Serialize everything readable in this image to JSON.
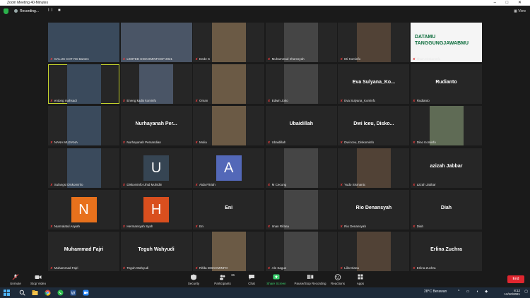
{
  "window": {
    "title": "Zoom Meeting 40-Minutes",
    "controls": "–  □  ✕"
  },
  "topbar": {
    "recording_label": "Recording...",
    "pause_label": "II ■",
    "view_label": "▦ View"
  },
  "participants": [
    {
      "name": "GALUS COT RS Banten",
      "type": "video"
    },
    {
      "name": "LIMITED DISKOMINFOSP 2021",
      "type": "video"
    },
    {
      "name": "Dede S",
      "type": "video"
    },
    {
      "name": "Muhammad Irhamsyah",
      "type": "video"
    },
    {
      "name": "Eti Kominfo",
      "type": "video"
    },
    {
      "name": "Ilham Diskomnfo",
      "type": "video",
      "banner": "DATAMU TANGGUNGJAWABMU"
    },
    {
      "name": "entong mahsadi",
      "type": "video",
      "active": true
    },
    {
      "name": "Eneng kadis kominfo",
      "type": "video"
    },
    {
      "name": "Oman",
      "type": "video"
    },
    {
      "name": "Edwin Joko",
      "type": "video"
    },
    {
      "name": "Eva Sulyana_Kominfo",
      "type": "text",
      "display": "Eva Sulyana_Ko..."
    },
    {
      "name": "Rudianto",
      "type": "text",
      "display": "Rudianto"
    },
    {
      "name": "NANA MUJIANA",
      "type": "video"
    },
    {
      "name": "Nurhayanah Persandian",
      "type": "text",
      "display": "Nurhayanah Per..."
    },
    {
      "name": "Mulia",
      "type": "video"
    },
    {
      "name": "Ubaidillah",
      "type": "text",
      "display": "Ubaidillah"
    },
    {
      "name": "Dwi Iceu, Diskominfo",
      "type": "text",
      "display": "Dwi Iceu, Disko..."
    },
    {
      "name": "Dino Kominfo",
      "type": "video"
    },
    {
      "name": "Sulangsi Diskominfo",
      "type": "video"
    },
    {
      "name": "Diskominfo Uhtd Muhidin",
      "type": "avatar",
      "letter": "U",
      "color": "#364553"
    },
    {
      "name": "Aida Fitriah",
      "type": "avatar",
      "letter": "A",
      "color": "#5368b8"
    },
    {
      "name": "M Cecung",
      "type": "video"
    },
    {
      "name": "Yudo Sismanto",
      "type": "video"
    },
    {
      "name": "azzah Jabbar",
      "type": "text",
      "display": "azizah Jabbar"
    },
    {
      "name": "Nurmalatul Asyiah",
      "type": "avatar",
      "letter": "N",
      "color": "#e8711c"
    },
    {
      "name": "Hermansyah Syah",
      "type": "avatar",
      "letter": "H",
      "color": "#d94f1e"
    },
    {
      "name": "Eni",
      "type": "text",
      "display": "Eni"
    },
    {
      "name": "Iman Rifana",
      "type": "video"
    },
    {
      "name": "Rio Denansyah",
      "type": "text",
      "display": "Rio Denansyah"
    },
    {
      "name": "Diah",
      "type": "text",
      "display": "Diah"
    },
    {
      "name": "Muhammad Fajri",
      "type": "text",
      "display": "Muhammad Fajri"
    },
    {
      "name": "Teguh Wahyudi",
      "type": "text",
      "display": "Teguh Wahyudi"
    },
    {
      "name": "Rifda DISKOMINFO",
      "type": "video"
    },
    {
      "name": "Ale Sagus",
      "type": "video"
    },
    {
      "name": "Lilis Diana",
      "type": "video"
    },
    {
      "name": "Erlina Zuchra",
      "type": "text",
      "display": "Erlina Zuchra"
    }
  ],
  "toolbar": {
    "unmute": "Unmute",
    "stop_video": "Stop Video",
    "security": "Security",
    "participants": "Participants",
    "participants_count": "36",
    "chat": "Chat",
    "share_screen": "Share Screen",
    "pause_recording": "Pause/Stop Recording",
    "reactions": "Reactions",
    "apps": "Apps",
    "end": "End"
  },
  "taskbar": {
    "weather": "28°C  Berawan",
    "time": "8:12",
    "date": "12/10/2021"
  },
  "colors": {
    "active_speaker": "#c4d22d",
    "end_button": "#e0262f",
    "share_green": "#3bd16f"
  }
}
